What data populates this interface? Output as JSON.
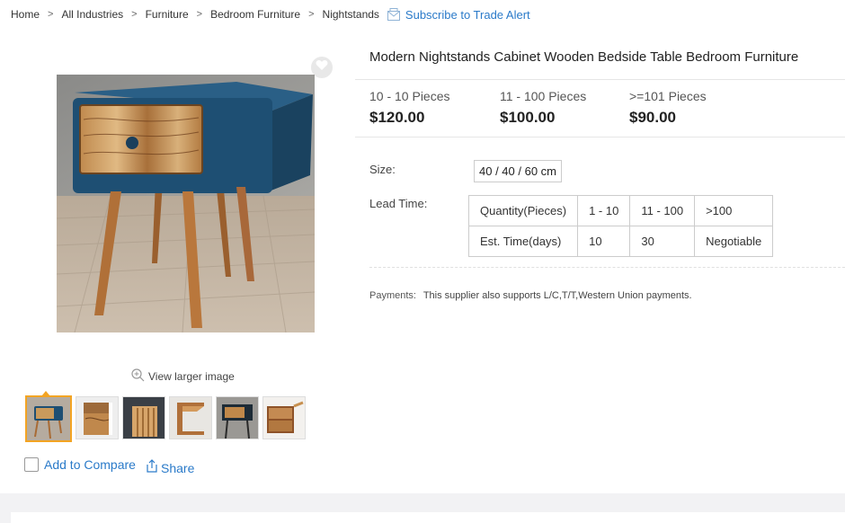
{
  "breadcrumb": {
    "items": [
      "Home",
      "All Industries",
      "Furniture",
      "Bedroom Furniture",
      "Nightstands"
    ],
    "separator": ">",
    "subscribe_label": "Subscribe to Trade Alert"
  },
  "gallery": {
    "view_larger_label": "View larger image",
    "thumbnail_count": 6,
    "active_thumbnail": 1
  },
  "actions": {
    "compare_label": "Add to Compare",
    "share_label": "Share"
  },
  "product": {
    "title": "Modern Nightstands Cabinet Wooden Bedside Table Bedroom Furniture",
    "price_tiers": [
      {
        "qty": "10 - 10 Pieces",
        "price": "$120.00"
      },
      {
        "qty": "11 - 100 Pieces",
        "price": "$100.00"
      },
      {
        "qty": ">=101 Pieces",
        "price": "$90.00"
      }
    ],
    "size_label": "Size:",
    "size_value": "40 / 40 / 60 cm",
    "lead_time_label": "Lead Time:",
    "lead_time_table": {
      "header": [
        "Quantity(Pieces)",
        "1 - 10",
        "11 - 100",
        ">100"
      ],
      "row": [
        "Est. Time(days)",
        "10",
        "30",
        "Negotiable"
      ]
    },
    "payments_label": "Payments:",
    "payments_text": "This supplier also supports L/C,T/T,Western Union payments."
  },
  "colors": {
    "link": "#2a7ac9",
    "thumb_active_border": "#f3a423",
    "cabinet_blue": "#1e4f73"
  }
}
